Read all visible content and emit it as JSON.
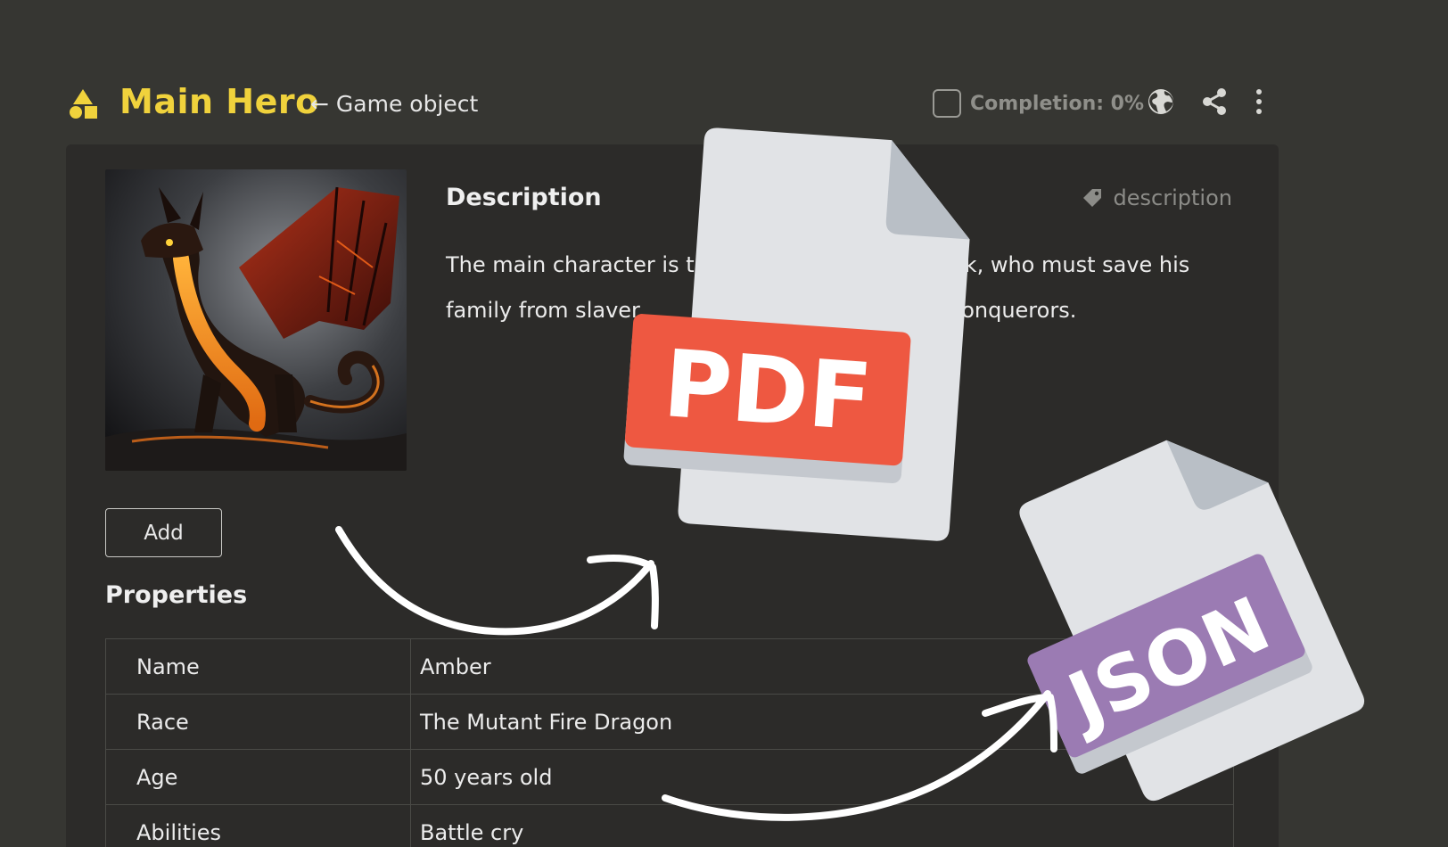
{
  "header": {
    "title": "Main Hero",
    "subtitle": "← Game object",
    "completion_label": "Completion: 0%"
  },
  "description": {
    "heading": "Description",
    "tag": "description",
    "text": "The main character is th                                    ck, who must save his family from slaver                                         of Conquerors."
  },
  "actions": {
    "add_label": "Add"
  },
  "properties": {
    "heading": "Properties",
    "rows": [
      {
        "key": "Name",
        "value": "Amber"
      },
      {
        "key": "Race",
        "value": "The Mutant Fire Dragon"
      },
      {
        "key": "Age",
        "value": "50 years old"
      },
      {
        "key": "Abilities",
        "value": "Battle cry"
      }
    ]
  },
  "badges": {
    "pdf": "PDF",
    "json": "JSON"
  },
  "colors": {
    "accent": "#f0d23c",
    "pdf": "#ee5841",
    "json": "#9b7bb3",
    "file": "#e1e3e6"
  },
  "icons": [
    "shapes-logo-icon",
    "globe-icon",
    "share-icon",
    "more-vertical-icon",
    "tag-icon",
    "pdf-file-icon",
    "json-file-icon",
    "arrow-icon"
  ]
}
